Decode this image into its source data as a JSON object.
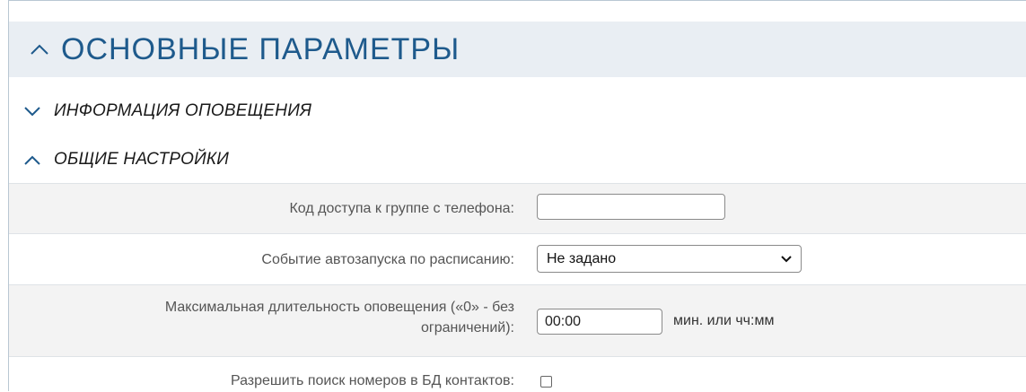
{
  "section": {
    "title": "ОСНОВНЫЕ ПАРАМЕТРЫ",
    "icon": "chevron-up-icon"
  },
  "subsections": [
    {
      "label": "ИНФОРМАЦИЯ ОПОВЕЩЕНИЯ",
      "icon": "chevron-down-icon",
      "expanded": false
    },
    {
      "label": "ОБЩИЕ НАСТРОЙКИ",
      "icon": "chevron-up-icon",
      "expanded": true
    }
  ],
  "settings": {
    "access_code": {
      "label": "Код доступа к группе с телефона:",
      "value": ""
    },
    "autostart_event": {
      "label": "Событие автозапуска по расписанию:",
      "selected": "Не задано"
    },
    "max_duration": {
      "label_line1": "Максимальная длительность оповещения («0» - без",
      "label_line2": "ограничений):",
      "value": "00:00",
      "unit": "мин. или чч:мм"
    },
    "allow_search": {
      "label": "Разрешить поиск номеров в БД контактов:",
      "checked": false
    }
  },
  "colors": {
    "header_bg": "#e9eef3",
    "header_text": "#1e5a8c",
    "row_alt_bg": "#f3f3f3"
  }
}
